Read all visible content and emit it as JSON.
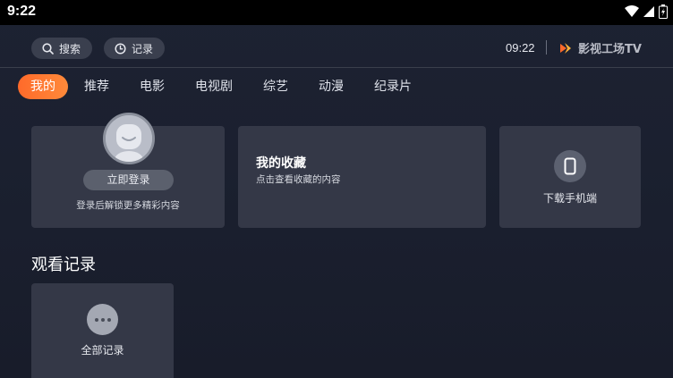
{
  "statusbar": {
    "time": "9:22",
    "icons": [
      "wifi-icon",
      "cell-signal-icon",
      "battery-icon"
    ]
  },
  "topbar": {
    "search_label": "搜索",
    "history_label": "记录",
    "clock": "09:22",
    "brand_name": "影视工场TV"
  },
  "tabs": [
    {
      "label": "我的",
      "active": true
    },
    {
      "label": "推荐"
    },
    {
      "label": "电影"
    },
    {
      "label": "电视剧"
    },
    {
      "label": "综艺"
    },
    {
      "label": "动漫"
    },
    {
      "label": "纪录片"
    }
  ],
  "login_card": {
    "button_label": "立即登录",
    "subtitle": "登录后解锁更多精彩内容"
  },
  "favorites_card": {
    "title": "我的收藏",
    "subtitle": "点击查看收藏的内容"
  },
  "download_card": {
    "label": "下载手机端"
  },
  "history_section": {
    "title": "观看记录",
    "all_label": "全部记录"
  },
  "colors": {
    "accent": "#ff6a2a",
    "background": "#1d2232",
    "card": "#343847"
  }
}
